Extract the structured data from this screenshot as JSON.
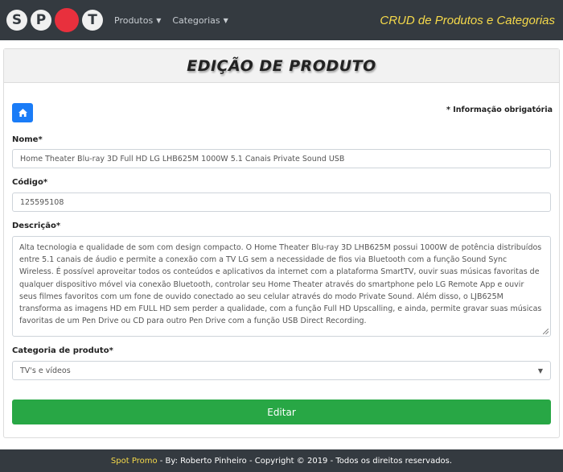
{
  "navbar": {
    "logo_letters": [
      "S",
      "P",
      "T"
    ],
    "menu": [
      {
        "label": "Produtos"
      },
      {
        "label": "Categorias"
      }
    ],
    "title": "CRUD de Produtos e Categorias"
  },
  "page": {
    "title": "EDIÇÃO DE PRODUTO",
    "required_note": "* Informação obrigatória"
  },
  "form": {
    "name_label": "Nome*",
    "name_value": "Home Theater Blu-ray 3D Full HD LG LHB625M 1000W 5.1 Canais Private Sound USB",
    "code_label": "Código*",
    "code_value": "125595108",
    "description_label": "Descrição*",
    "description_value": "Alta tecnologia e qualidade de som com design compacto. O Home Theater Blu-ray 3D LHB625M possui 1000W de potência distribuídos entre 5.1 canais de áudio e permite a conexão com a TV LG sem a necessidade de fios via Bluetooth com a função Sound Sync Wireless. É possível aproveitar todos os conteúdos e aplicativos da internet com a plataforma SmartTV, ouvir suas músicas favoritas de qualquer dispositivo móvel via conexão Bluetooth, controlar seu Home Theater através do smartphone pelo LG Remote App e ouvir seus filmes favoritos com um fone de ouvido conectado ao seu celular através do modo Private Sound. Além disso, o LJB625M transforma as imagens HD em FULL HD sem perder a qualidade, com a função Full HD Upscalling, e ainda, permite gravar suas músicas favoritas de um Pen Drive ou CD para outro Pen Drive com a função USB Direct Recording.",
    "category_label": "Categoria de produto*",
    "category_value": "TV's e vídeos",
    "submit_label": "Editar"
  },
  "footer": {
    "brand": "Spot Promo",
    "text": " - By: Roberto Pinheiro - Copyright © 2019 - Todos os direitos reservados."
  },
  "colors": {
    "navbar_bg": "#343a40",
    "accent_yellow": "#f5d94a",
    "logo_red": "#e8303d",
    "primary": "#1a7cf7",
    "success": "#28a745"
  },
  "icons": {
    "home": "home-icon",
    "dropdown": "caret-down-icon",
    "select": "select-arrow-icon"
  }
}
